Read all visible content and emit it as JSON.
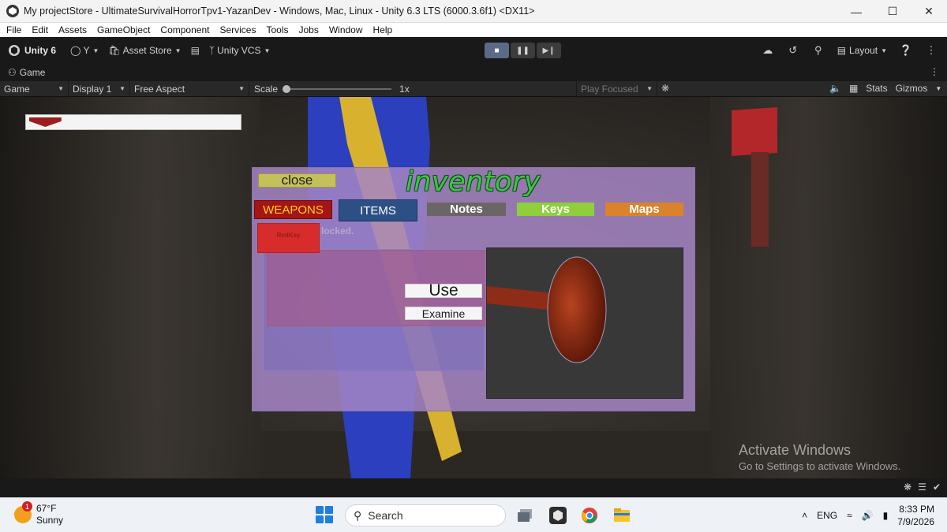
{
  "window": {
    "title": "My projectStore - UltimateSurvivalHorrorTpv1-YazanDev - Windows, Mac, Linux - Unity 6.3 LTS (6000.3.6f1) <DX11>"
  },
  "menu": [
    "File",
    "Edit",
    "Assets",
    "GameObject",
    "Component",
    "Services",
    "Tools",
    "Jobs",
    "Window",
    "Help"
  ],
  "toolbar": {
    "unity_label": "Unity 6",
    "account_label": "Y",
    "asset_store_label": "Asset Store",
    "vcs_label": "Unity VCS",
    "layout_label": "Layout"
  },
  "game_tab": {
    "label": "Game"
  },
  "game_bar": {
    "mode": "Game",
    "display": "Display 1",
    "aspect": "Free Aspect",
    "scale_label": "Scale",
    "scale_value": "1x",
    "play_mode": "Play Focused",
    "stats": "Stats",
    "gizmos": "Gizmos"
  },
  "hud": {
    "health_fraction": 0.15
  },
  "inventory": {
    "title": "inventory",
    "close_label": "close",
    "tabs": {
      "weapons": "WEAPONS",
      "items": "ITEMS",
      "notes": "Notes",
      "keys": "Keys",
      "maps": "Maps"
    },
    "slot_label": "RedKey",
    "locked_text": "locked.",
    "use_label": "Use",
    "examine_label": "Examine"
  },
  "watermark": {
    "line1": "Activate Windows",
    "line2": "Go to Settings to activate Windows."
  },
  "taskbar": {
    "temperature": "67°F",
    "weather": "Sunny",
    "weather_badge": "1",
    "search_placeholder": "Search",
    "language": "ENG",
    "time": "8:33 PM",
    "date": "7/9/2026"
  }
}
